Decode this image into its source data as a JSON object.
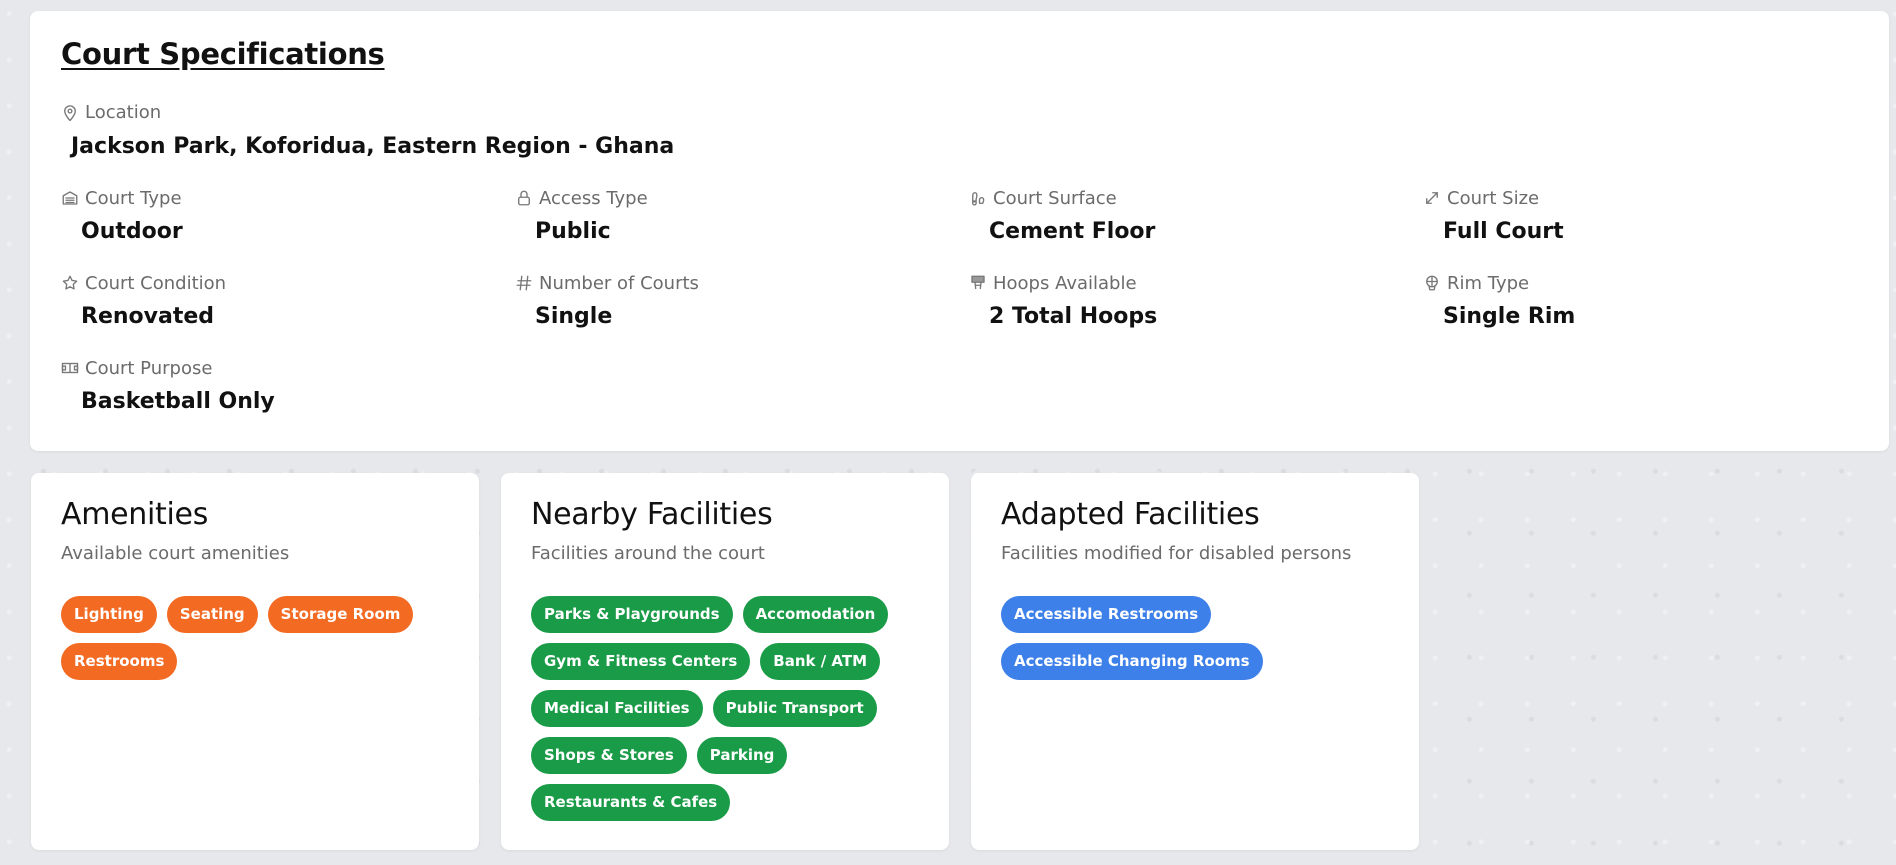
{
  "specs": {
    "title": "Court Specifications",
    "location": {
      "label": "Location",
      "value": "Jackson Park, Koforidua, Eastern Region - Ghana",
      "icon": "map-pin-icon"
    },
    "items": [
      {
        "label": "Court Type",
        "value": "Outdoor",
        "icon": "building-icon"
      },
      {
        "label": "Access Type",
        "value": "Public",
        "icon": "lock-icon"
      },
      {
        "label": "Court Surface",
        "value": "Cement Floor",
        "icon": "footprints-icon"
      },
      {
        "label": "Court Size",
        "value": "Full Court",
        "icon": "expand-arrows-icon"
      },
      {
        "label": "Court Condition",
        "value": "Renovated",
        "icon": "star-icon"
      },
      {
        "label": "Number of Courts",
        "value": "Single",
        "icon": "hash-icon"
      },
      {
        "label": "Hoops Available",
        "value": "2 Total Hoops",
        "icon": "hoop-icon"
      },
      {
        "label": "Rim Type",
        "value": "Single Rim",
        "icon": "basketball-rim-icon"
      },
      {
        "label": "Court Purpose",
        "value": "Basketball Only",
        "icon": "court-icon"
      }
    ]
  },
  "amenities": {
    "title": "Amenities",
    "subtitle": "Available court amenities",
    "chips": [
      "Lighting",
      "Seating",
      "Storage Room",
      "Restrooms"
    ],
    "color": "#f36a22"
  },
  "nearby": {
    "title": "Nearby Facilities",
    "subtitle": "Facilities around the court",
    "chips": [
      "Parks & Playgrounds",
      "Accomodation",
      "Gym & Fitness Centers",
      "Bank / ATM",
      "Medical Facilities",
      "Public Transport",
      "Shops & Stores",
      "Parking",
      "Restaurants & Cafes"
    ],
    "color": "#1a9b47"
  },
  "adapted": {
    "title": "Adapted Facilities",
    "subtitle": "Facilities modified for disabled persons",
    "chips": [
      "Accessible Restrooms",
      "Accessible Changing Rooms"
    ],
    "color": "#3d80ea"
  }
}
